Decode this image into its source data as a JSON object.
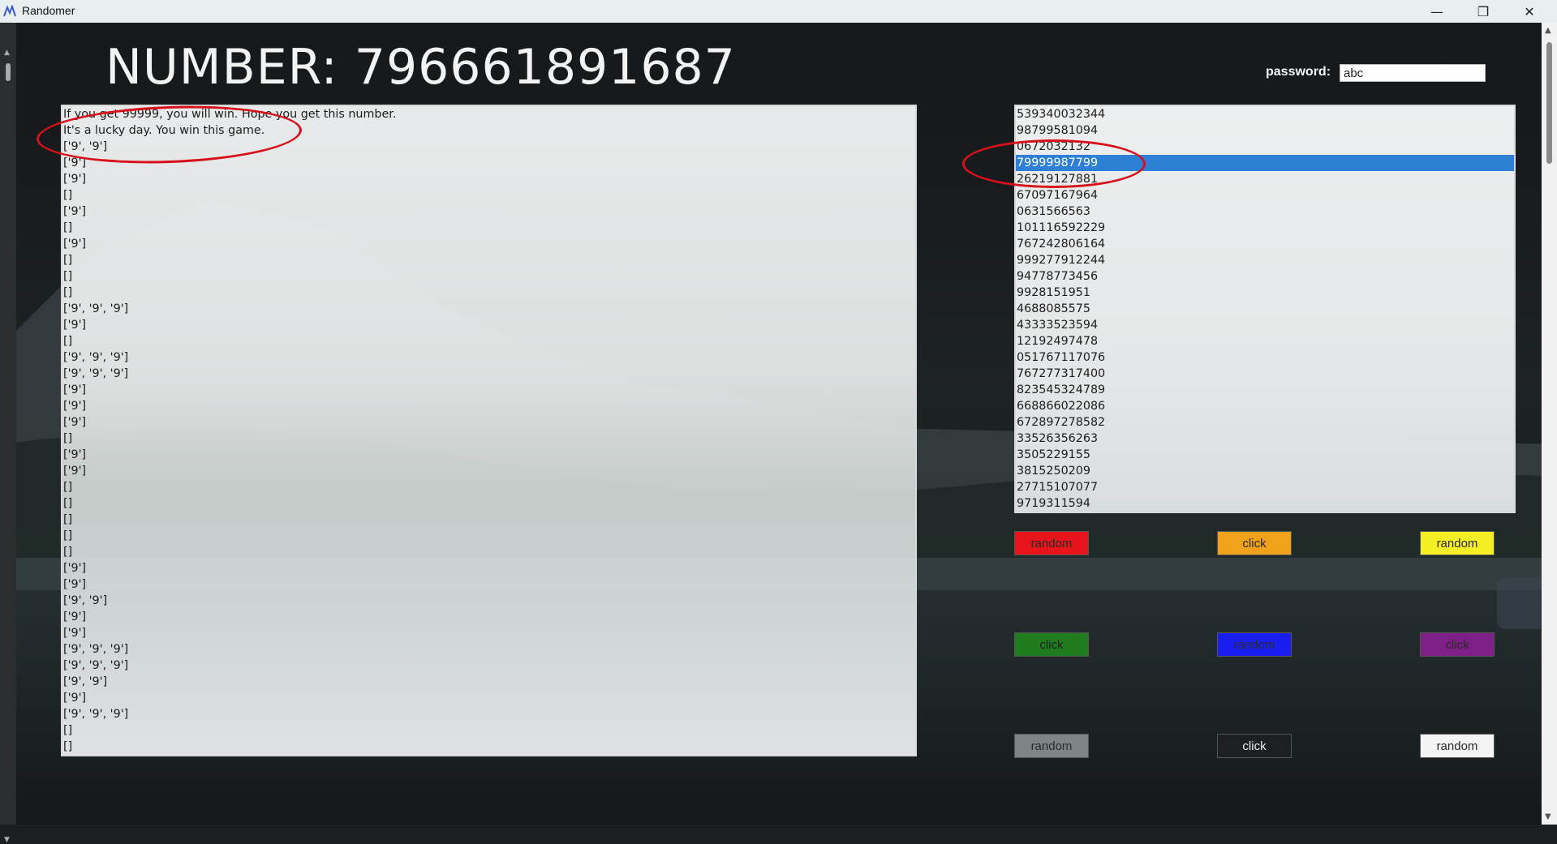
{
  "window": {
    "title": "Randomer",
    "minimize_glyph": "—",
    "restore_glyph": "❐",
    "close_glyph": "✕"
  },
  "header": {
    "number_label": "NUMBER: 796661891687",
    "password_label": "password:",
    "password_value": "abc"
  },
  "log": {
    "lines": [
      "If you get 99999, you will win. Hope you get this number.",
      "It's a lucky day. You win this game.",
      "['9', '9']",
      "['9']",
      "['9']",
      "[]",
      "['9']",
      "[]",
      "['9']",
      "[]",
      "[]",
      "[]",
      "['9', '9', '9']",
      "['9']",
      "[]",
      "['9', '9', '9']",
      "['9', '9', '9']",
      "['9']",
      "['9']",
      "['9']",
      "[]",
      "['9']",
      "['9']",
      "[]",
      "[]",
      "[]",
      "[]",
      "[]",
      "['9']",
      "['9']",
      "['9', '9']",
      "['9']",
      "['9']",
      "['9', '9', '9']",
      "['9', '9', '9']",
      "['9', '9']",
      "['9']",
      "['9', '9', '9']",
      "[]",
      "[]"
    ]
  },
  "number_list": {
    "selected_index": 3,
    "items": [
      "539340032344",
      "98799581094",
      "0672032132",
      "79999987799",
      "26219127881",
      "67097167964",
      "0631566563",
      "101116592229",
      "767242806164",
      "999277912244",
      "94778773456",
      "9928151951",
      "4688085575",
      "43333523594",
      "12192497478",
      "051767117076",
      "767277317400",
      "823545324789",
      "668866022086",
      "672897278582",
      "33526356263",
      "3505229155",
      "3815250209",
      "27715107077",
      "9719311594"
    ]
  },
  "buttons": [
    {
      "label": "random",
      "color": "#e8141c",
      "text_color": "#2a2a2a"
    },
    {
      "label": "click",
      "color": "#f0a21a",
      "text_color": "#2a2a2a"
    },
    {
      "label": "random",
      "color": "#f5ef25",
      "text_color": "#2a2a2a"
    },
    {
      "label": "click",
      "color": "#1f7d1f",
      "text_color": "#1f1f1f"
    },
    {
      "label": "random",
      "color": "#1a1ef0",
      "text_color": "#2a2a2a"
    },
    {
      "label": "click",
      "color": "#7d1f86",
      "text_color": "#2a2a2a"
    },
    {
      "label": "random",
      "color": "#7f8486",
      "text_color": "#2a2a2a"
    },
    {
      "label": "click",
      "color": "#1d2022",
      "text_color": "#eeeeee"
    },
    {
      "label": "random",
      "color": "#f4f4f4",
      "text_color": "#2a2a2a"
    }
  ],
  "colors": {
    "selection": "#2e7fd6",
    "annotation": "#d8101a"
  }
}
